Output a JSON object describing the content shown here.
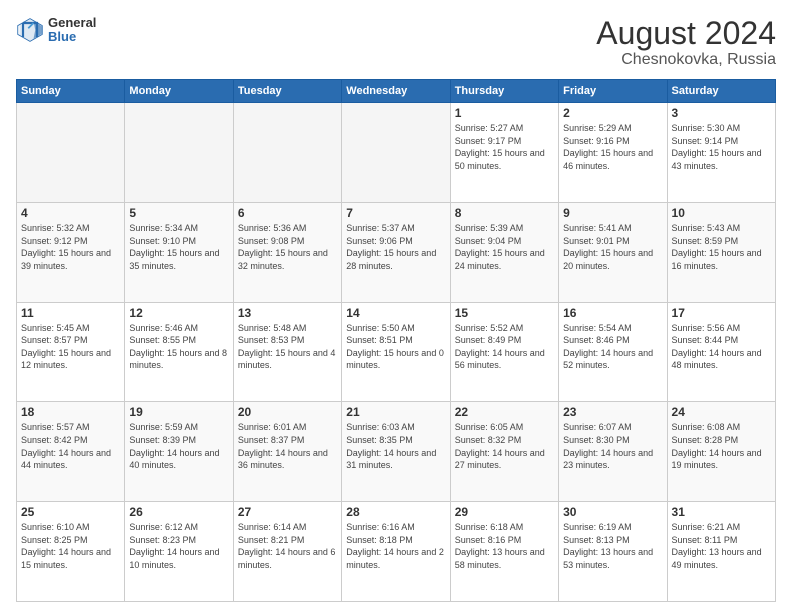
{
  "header": {
    "logo_general": "General",
    "logo_blue": "Blue",
    "month_year": "August 2024",
    "location": "Chesnokovka, Russia"
  },
  "days_of_week": [
    "Sunday",
    "Monday",
    "Tuesday",
    "Wednesday",
    "Thursday",
    "Friday",
    "Saturday"
  ],
  "weeks": [
    [
      {
        "day": "",
        "empty": true
      },
      {
        "day": "",
        "empty": true
      },
      {
        "day": "",
        "empty": true
      },
      {
        "day": "",
        "empty": true
      },
      {
        "day": "1",
        "sunrise": "5:27 AM",
        "sunset": "9:17 PM",
        "daylight": "15 hours and 50 minutes."
      },
      {
        "day": "2",
        "sunrise": "5:29 AM",
        "sunset": "9:16 PM",
        "daylight": "15 hours and 46 minutes."
      },
      {
        "day": "3",
        "sunrise": "5:30 AM",
        "sunset": "9:14 PM",
        "daylight": "15 hours and 43 minutes."
      }
    ],
    [
      {
        "day": "4",
        "sunrise": "5:32 AM",
        "sunset": "9:12 PM",
        "daylight": "15 hours and 39 minutes."
      },
      {
        "day": "5",
        "sunrise": "5:34 AM",
        "sunset": "9:10 PM",
        "daylight": "15 hours and 35 minutes."
      },
      {
        "day": "6",
        "sunrise": "5:36 AM",
        "sunset": "9:08 PM",
        "daylight": "15 hours and 32 minutes."
      },
      {
        "day": "7",
        "sunrise": "5:37 AM",
        "sunset": "9:06 PM",
        "daylight": "15 hours and 28 minutes."
      },
      {
        "day": "8",
        "sunrise": "5:39 AM",
        "sunset": "9:04 PM",
        "daylight": "15 hours and 24 minutes."
      },
      {
        "day": "9",
        "sunrise": "5:41 AM",
        "sunset": "9:01 PM",
        "daylight": "15 hours and 20 minutes."
      },
      {
        "day": "10",
        "sunrise": "5:43 AM",
        "sunset": "8:59 PM",
        "daylight": "15 hours and 16 minutes."
      }
    ],
    [
      {
        "day": "11",
        "sunrise": "5:45 AM",
        "sunset": "8:57 PM",
        "daylight": "15 hours and 12 minutes."
      },
      {
        "day": "12",
        "sunrise": "5:46 AM",
        "sunset": "8:55 PM",
        "daylight": "15 hours and 8 minutes."
      },
      {
        "day": "13",
        "sunrise": "5:48 AM",
        "sunset": "8:53 PM",
        "daylight": "15 hours and 4 minutes."
      },
      {
        "day": "14",
        "sunrise": "5:50 AM",
        "sunset": "8:51 PM",
        "daylight": "15 hours and 0 minutes."
      },
      {
        "day": "15",
        "sunrise": "5:52 AM",
        "sunset": "8:49 PM",
        "daylight": "14 hours and 56 minutes."
      },
      {
        "day": "16",
        "sunrise": "5:54 AM",
        "sunset": "8:46 PM",
        "daylight": "14 hours and 52 minutes."
      },
      {
        "day": "17",
        "sunrise": "5:56 AM",
        "sunset": "8:44 PM",
        "daylight": "14 hours and 48 minutes."
      }
    ],
    [
      {
        "day": "18",
        "sunrise": "5:57 AM",
        "sunset": "8:42 PM",
        "daylight": "14 hours and 44 minutes."
      },
      {
        "day": "19",
        "sunrise": "5:59 AM",
        "sunset": "8:39 PM",
        "daylight": "14 hours and 40 minutes."
      },
      {
        "day": "20",
        "sunrise": "6:01 AM",
        "sunset": "8:37 PM",
        "daylight": "14 hours and 36 minutes."
      },
      {
        "day": "21",
        "sunrise": "6:03 AM",
        "sunset": "8:35 PM",
        "daylight": "14 hours and 31 minutes."
      },
      {
        "day": "22",
        "sunrise": "6:05 AM",
        "sunset": "8:32 PM",
        "daylight": "14 hours and 27 minutes."
      },
      {
        "day": "23",
        "sunrise": "6:07 AM",
        "sunset": "8:30 PM",
        "daylight": "14 hours and 23 minutes."
      },
      {
        "day": "24",
        "sunrise": "6:08 AM",
        "sunset": "8:28 PM",
        "daylight": "14 hours and 19 minutes."
      }
    ],
    [
      {
        "day": "25",
        "sunrise": "6:10 AM",
        "sunset": "8:25 PM",
        "daylight": "14 hours and 15 minutes."
      },
      {
        "day": "26",
        "sunrise": "6:12 AM",
        "sunset": "8:23 PM",
        "daylight": "14 hours and 10 minutes."
      },
      {
        "day": "27",
        "sunrise": "6:14 AM",
        "sunset": "8:21 PM",
        "daylight": "14 hours and 6 minutes."
      },
      {
        "day": "28",
        "sunrise": "6:16 AM",
        "sunset": "8:18 PM",
        "daylight": "14 hours and 2 minutes."
      },
      {
        "day": "29",
        "sunrise": "6:18 AM",
        "sunset": "8:16 PM",
        "daylight": "13 hours and 58 minutes."
      },
      {
        "day": "30",
        "sunrise": "6:19 AM",
        "sunset": "8:13 PM",
        "daylight": "13 hours and 53 minutes."
      },
      {
        "day": "31",
        "sunrise": "6:21 AM",
        "sunset": "8:11 PM",
        "daylight": "13 hours and 49 minutes."
      }
    ]
  ]
}
